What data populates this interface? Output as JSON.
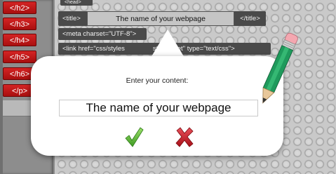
{
  "sidebar": {
    "tags": [
      "</h2>",
      "</h3>",
      "</h4>",
      "</h5>",
      "</h6>",
      "</p>"
    ]
  },
  "editor": {
    "head_tag": "<head>",
    "title_open": "<title>",
    "title_value": "The name of your webpage",
    "title_close": "</title>",
    "meta_line": "<meta charset=\"UTF-8\">",
    "link_line_start": "<link href=\"css/styles",
    "link_line_end": "stylesheet\" type=\"text/css\">"
  },
  "dialog": {
    "prompt": "Enter your content:",
    "input_value": "The name of your webpage"
  },
  "colors": {
    "tag_red": "#c21a1a",
    "confirm_green": "#6cc43a",
    "cancel_red": "#c8202a",
    "pencil_green": "#1f9a5c"
  }
}
